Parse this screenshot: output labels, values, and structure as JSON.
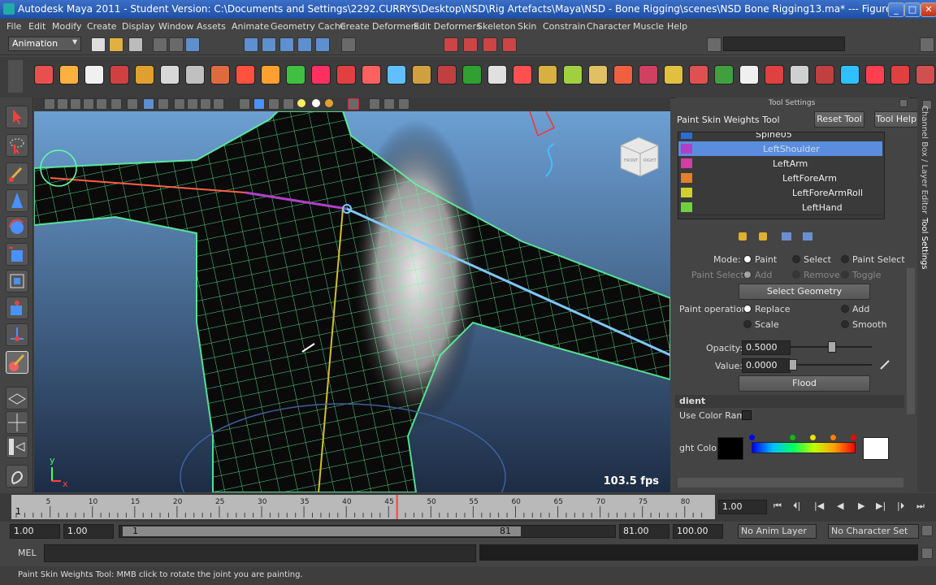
{
  "window": {
    "title": "Autodesk Maya 2011 - Student Version: C:\\Documents and Settings\\2292.CURRYS\\Desktop\\NSD\\Rig Artefacts\\Maya\\NSD - Bone Rigging\\scenes\\NSD Bone Rigging13.ma*   ---   Figure",
    "minimize": "_",
    "maximize": "□",
    "close": "✕"
  },
  "menu": [
    "File",
    "Edit",
    "Modify",
    "Create",
    "Display",
    "Window",
    "Assets",
    "Animate",
    "Geometry Cache",
    "Create Deformers",
    "Edit Deformers",
    "Skeleton",
    "Skin",
    "Constrain",
    "Character",
    "Muscle",
    "Help"
  ],
  "statusline": {
    "menuset": "Animation"
  },
  "viewport": {
    "fps": "103.5 fps",
    "axis_y": "y",
    "axis_x": "x",
    "viewcube_left": "FRONT",
    "viewcube_right": "RIGHT"
  },
  "tool_settings": {
    "panel_title": "Tool Settings",
    "tool_name": "Paint Skin Weights Tool",
    "reset_button": "Reset Tool",
    "help_button": "Tool Help",
    "influences": [
      {
        "name": "Spine05",
        "color": "#2a6fd0",
        "indent": 95,
        "selected": false
      },
      {
        "name": "LeftShoulder",
        "color": "#b040c8",
        "indent": 104,
        "selected": true
      },
      {
        "name": "LeftArm",
        "color": "#d040a0",
        "indent": 116,
        "selected": false
      },
      {
        "name": "LeftForeArm",
        "color": "#e08030",
        "indent": 128,
        "selected": false
      },
      {
        "name": "LeftForeArmRoll",
        "color": "#d0d030",
        "indent": 140,
        "selected": false
      },
      {
        "name": "LeftHand",
        "color": "#70d040",
        "indent": 152,
        "selected": false
      }
    ],
    "mode_label": "Mode:",
    "mode_paint": "Paint",
    "mode_select": "Select",
    "mode_paint_select": "Paint Select",
    "paint_select_label": "Paint Select:",
    "ps_add": "Add",
    "ps_remove": "Remove",
    "ps_toggle": "Toggle",
    "select_geometry": "Select Geometry",
    "paint_op_label": "Paint operation:",
    "op_replace": "Replace",
    "op_add": "Add",
    "op_scale": "Scale",
    "op_smooth": "Smooth",
    "opacity_label": "Opacity:",
    "opacity_value": "0.5000",
    "value_label": "Value:",
    "value_value": "0.0000",
    "flood_button": "Flood",
    "gradient_header": "dient",
    "use_color_ramp": "Use Color Ramp",
    "weight_color_label": "ght Color:",
    "opacity_fill": 0.5,
    "value_fill": 0.0
  },
  "side_tabs": {
    "channel_box": "Channel Box / Layer Editor",
    "tool_settings": "Tool Settings"
  },
  "timeline": {
    "ticks": [
      "5",
      "10",
      "15",
      "20",
      "25",
      "30",
      "35",
      "40",
      "45",
      "50",
      "55",
      "60",
      "65",
      "70",
      "75",
      "80"
    ],
    "first_frame": "1",
    "current_time": "1.00",
    "current_frame": 46
  },
  "range": {
    "start": "1.00",
    "anim_start": "1.00",
    "slider_start": "1",
    "slider_end": "81",
    "anim_end": "81.00",
    "end": "100.00",
    "anim_layer": "No Anim Layer",
    "character_set": "No Character Set"
  },
  "command_line": {
    "lang": "MEL"
  },
  "help_line": {
    "text": "Paint Skin Weights Tool: MMB click to rotate the joint you are painting."
  },
  "colors": {
    "accent": "#6aa0ff",
    "wireframe": "#60ff9a",
    "selection": "#5b8dde"
  }
}
